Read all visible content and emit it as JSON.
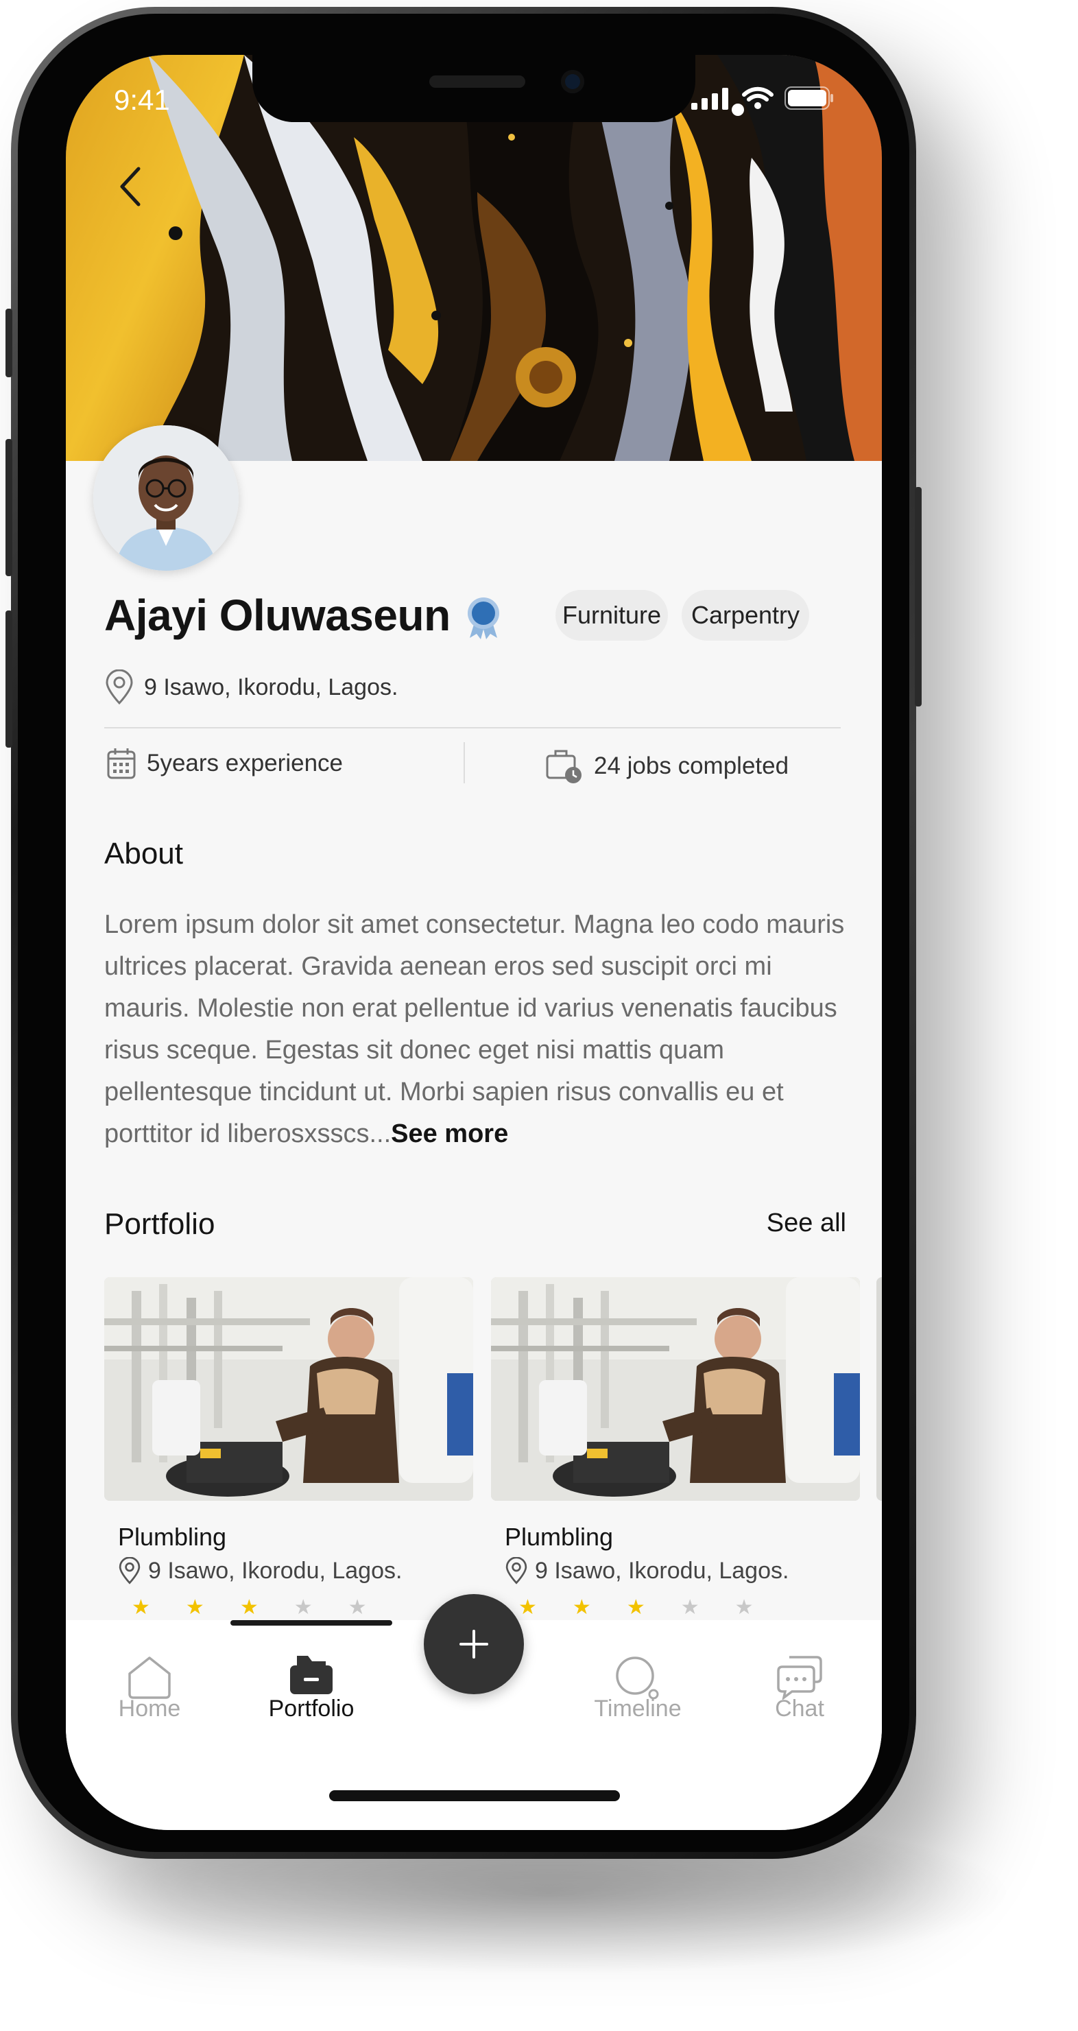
{
  "status_bar": {
    "time": "9:41"
  },
  "profile": {
    "name": "Ajayi Oluwaseun",
    "location": "9 Isawo, Ikorodu, Lagos.",
    "tags": [
      "Furniture",
      "Carpentry"
    ],
    "experience": "5years experience",
    "jobs_completed": "24 jobs completed"
  },
  "about": {
    "title": "About",
    "text": "Lorem ipsum dolor sit amet consectetur. Magna leo codo mauris ultrices placerat. Gravida aenean eros sed suscipit orci mi mauris. Molestie non erat pellentue id varius venenatis faucibus risus sceque. Egestas sit donec eget nisi mattis quam pellentesque tincidunt ut. Morbi sapien risus convallis eu et porttitor id liberosxsscs...",
    "see_more": "See more"
  },
  "portfolio": {
    "title": "Portfolio",
    "see_all": "See all",
    "items": [
      {
        "title": "Plumbling",
        "location": "9 Isawo, Ikorodu, Lagos.",
        "rating": 3
      },
      {
        "title": "Plumbling",
        "location": "9 Isawo, Ikorodu, Lagos.",
        "rating": 3
      }
    ]
  },
  "bottom_nav": {
    "items": [
      {
        "label": "Home",
        "icon": "home-icon",
        "active": false
      },
      {
        "label": "Portfolio",
        "icon": "folder-icon",
        "active": true
      },
      {
        "label": "Timeline",
        "icon": "timeline-icon",
        "active": false
      },
      {
        "label": "Chat",
        "icon": "chat-icon",
        "active": false
      }
    ],
    "fab_icon": "plus-icon"
  },
  "colors": {
    "accent_dark": "#333333",
    "badge_blue": "#2f6fb5",
    "star_yellow": "#f2c200",
    "star_gray": "#c8c8c8",
    "inactive_nav": "#a8a8a8"
  }
}
